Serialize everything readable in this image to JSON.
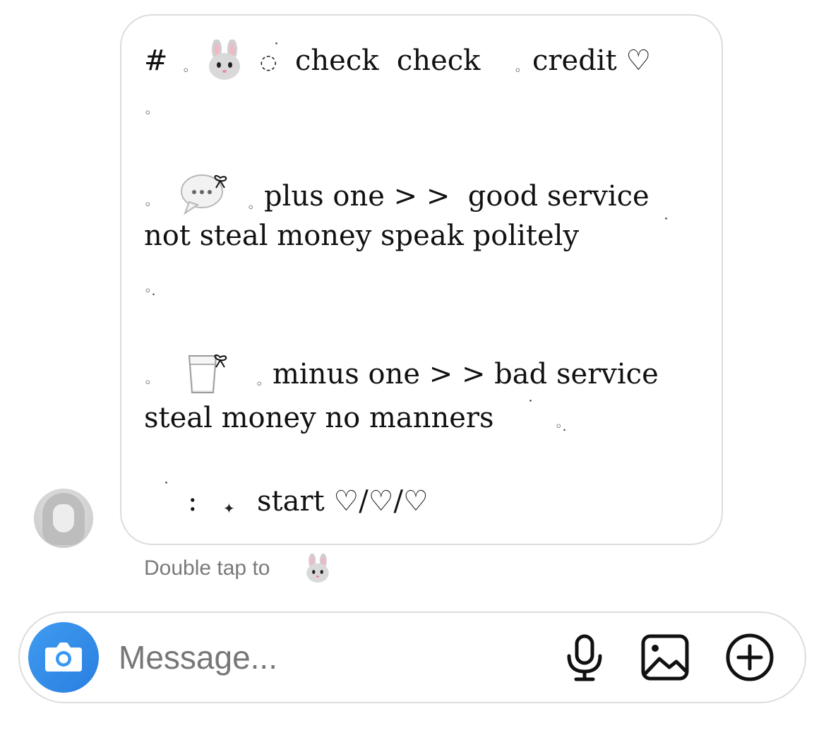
{
  "message": {
    "lines": [
      "#",
      "check  check",
      "credit ♡",
      "plus one > >  good service",
      "not steal money speak politely",
      "minus one > > bad service",
      "steal money no manners",
      "start ♡/♡/♡"
    ],
    "small_marks": {
      "circle": "◦",
      "dotted_circle": "◌",
      "dot_circle": "◦.",
      "colon": ":",
      "sparkle": "✦",
      "tick": "˙"
    }
  },
  "reaction_hint": "Double tap to",
  "composer": {
    "placeholder": "Message..."
  },
  "icons": {
    "camera": "camera-icon",
    "microphone": "microphone-icon",
    "gallery": "gallery-icon",
    "add": "plus-circle-icon",
    "bunny": "bunny-emoji",
    "speech": "speech-bubble-emoji",
    "milk": "milk-glass-emoji",
    "bow": "bow-icon"
  },
  "colors": {
    "accent": "#3897f0",
    "bubble_border": "#dcdcdc",
    "hint_text": "#7a7a7a",
    "placeholder": "#777777"
  }
}
